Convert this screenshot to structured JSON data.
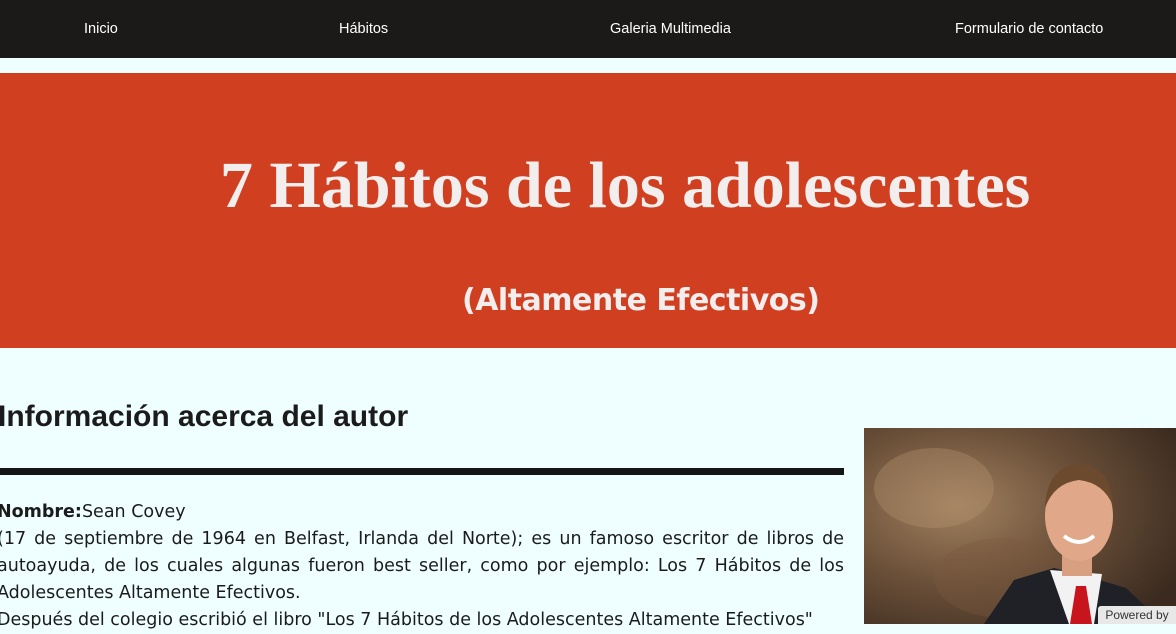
{
  "nav": {
    "items": [
      {
        "label": "Inicio"
      },
      {
        "label": "Hábitos"
      },
      {
        "label": "Galeria Multimedia"
      },
      {
        "label": "Formulario de contacto"
      }
    ]
  },
  "banner": {
    "title": "7 Hábitos de los adolescentes",
    "subtitle": "(Altamente Efectivos)",
    "background_color": "#d13f21"
  },
  "author": {
    "heading": "Información acerca del autor",
    "name_label": "Nombre:",
    "name_value": "Sean Covey",
    "paragraph1": "(17 de septiembre de 1964 en Belfast, Irlanda del Norte); es un famoso escritor de libros de autoayuda, de los cuales algunas fueron best seller, como por ejemplo: Los 7 Hábitos de los Adolescentes Altamente Efectivos.",
    "paragraph2": "Después del colegio escribió el libro \"Los 7 Hábitos de los Adolescentes Altamente Efectivos\""
  },
  "badge": {
    "powered_label": "Powered by"
  },
  "colors": {
    "nav_background": "#1c1a19",
    "page_background": "#efffff"
  }
}
